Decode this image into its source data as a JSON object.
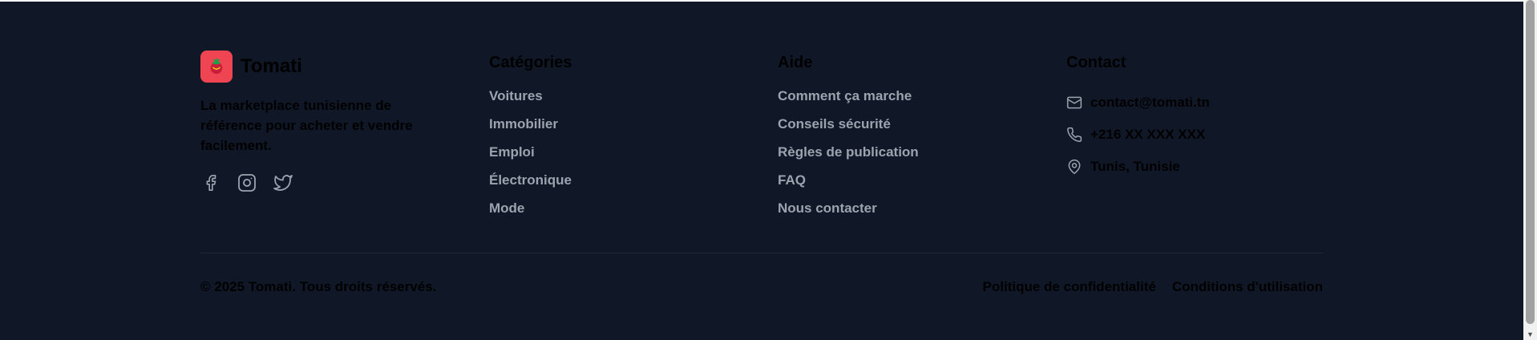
{
  "brand": {
    "name": "Tomati",
    "tagline": "La marketplace tunisienne de référence pour acheter et vendre facilement.",
    "logo_color": "#ef4451",
    "socials": [
      "facebook-icon",
      "instagram-icon",
      "twitter-icon"
    ]
  },
  "categories": {
    "title": "Catégories",
    "links": [
      "Voitures",
      "Immobilier",
      "Emploi",
      "Électronique",
      "Mode"
    ]
  },
  "help": {
    "title": "Aide",
    "links": [
      "Comment ça marche",
      "Conseils sécurité",
      "Règles de publication",
      "FAQ",
      "Nous contacter"
    ]
  },
  "contact": {
    "title": "Contact",
    "email": "contact@tomati.tn",
    "phone": "+216 XX XXX XXX",
    "location": "Tunis, Tunisie",
    "icons": [
      "mail-icon",
      "phone-icon",
      "map-pin-icon"
    ]
  },
  "bottom": {
    "copyright": "© 2025 Tomati. Tous droits réservés.",
    "privacy": "Politique de confidentialité",
    "terms": "Conditions d'utilisation"
  },
  "colors": {
    "background": "#101827",
    "link": "#9ca3af",
    "icon": "#9ca3af",
    "divider": "#1f2937",
    "accent": "#ef4451"
  }
}
